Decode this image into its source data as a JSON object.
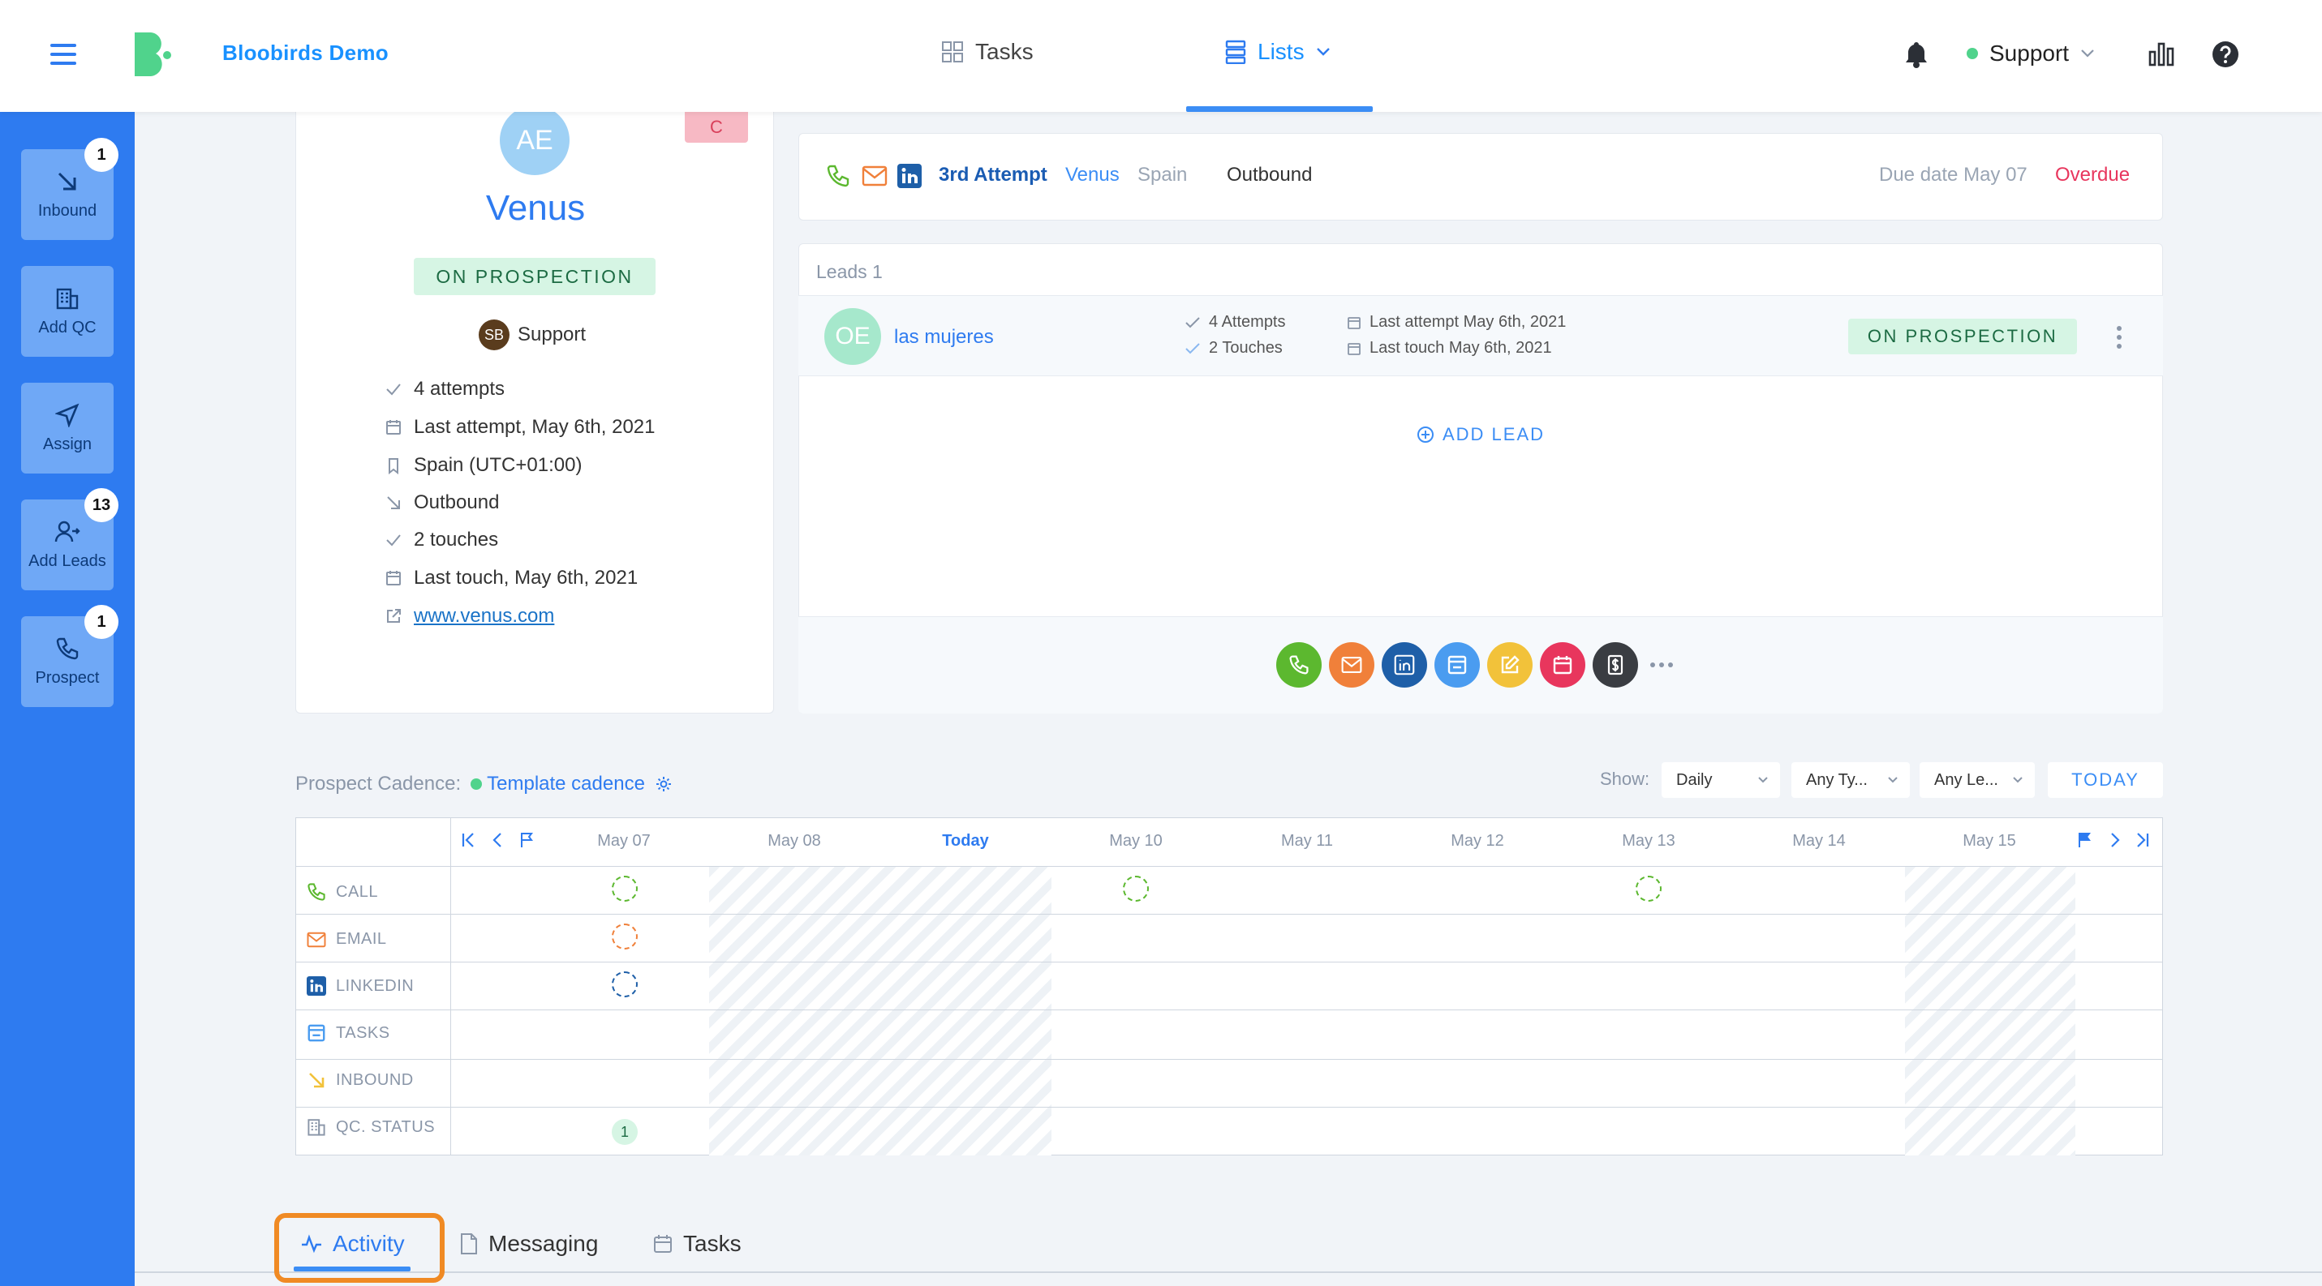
{
  "app": {
    "name": "Bloobirds Demo",
    "brand_color": "#2e7bf0",
    "logo_color": "#50d38c"
  },
  "topnav": {
    "tasks_label": "Tasks",
    "lists_label": "Lists",
    "user_label": "Support",
    "icons": [
      "menu-icon",
      "bell-icon",
      "chart-icon",
      "help-icon"
    ]
  },
  "sidebar": {
    "items": [
      {
        "label": "Inbound",
        "badge": "1",
        "icon": "arrow-down-right-icon"
      },
      {
        "label": "Add QC",
        "badge": "",
        "icon": "building-icon"
      },
      {
        "label": "Assign",
        "badge": "",
        "icon": "send-icon"
      },
      {
        "label": "Add Leads",
        "badge": "13",
        "icon": "user-plus-icon"
      },
      {
        "label": "Prospect",
        "badge": "1",
        "icon": "phone-icon"
      }
    ]
  },
  "company": {
    "initials": "AE",
    "name": "Venus",
    "score": "C",
    "status": "ON PROSPECTION",
    "owner_initials": "SB",
    "owner": "Support",
    "info": [
      {
        "icon": "check-icon",
        "text": "4 attempts"
      },
      {
        "icon": "calendar-icon",
        "text": "Last attempt, May 6th, 2021"
      },
      {
        "icon": "bookmark-icon",
        "text": "Spain (UTC+01:00)"
      },
      {
        "icon": "arrow-down-right-icon",
        "text": "Outbound"
      },
      {
        "icon": "check-icon",
        "text": "2 touches"
      },
      {
        "icon": "calendar-icon",
        "text": "Last touch, May 6th, 2021"
      },
      {
        "icon": "external-link-icon",
        "text": "www.venus.com"
      }
    ]
  },
  "task": {
    "attempt": "3rd Attempt",
    "company": "Venus",
    "country": "Spain",
    "source": "Outbound",
    "due_label": "Due date May 07",
    "overdue": "Overdue"
  },
  "leads": {
    "header": "Leads 1",
    "items": [
      {
        "initials": "OE",
        "name": "las mujeres",
        "attempts": "4 Attempts",
        "touches": "2 Touches",
        "last_attempt": "Last attempt May 6th, 2021",
        "last_touch": "Last touch May 6th, 2021",
        "status": "ON PROSPECTION"
      }
    ],
    "add_label": "ADD LEAD"
  },
  "actions": [
    {
      "name": "call",
      "color": "#5cb82f",
      "icon": "phone-icon"
    },
    {
      "name": "email",
      "color": "#f0803a",
      "icon": "mail-icon"
    },
    {
      "name": "linkedin",
      "color": "#1e5fa8",
      "icon": "linkedin-icon"
    },
    {
      "name": "task",
      "color": "#4a9cf0",
      "icon": "task-icon"
    },
    {
      "name": "note",
      "color": "#f2c23a",
      "icon": "edit-icon"
    },
    {
      "name": "meeting",
      "color": "#e8365d",
      "icon": "calendar-icon"
    },
    {
      "name": "deal",
      "color": "#3a3d42",
      "icon": "dollar-icon"
    }
  ],
  "cadence": {
    "label": "Prospect Cadence:",
    "name": "Template cadence",
    "show_label": "Show:",
    "filters": [
      "Daily",
      "Any Ty...",
      "Any Le..."
    ],
    "today_button": "TODAY",
    "days": [
      "May 07",
      "May 08",
      "Today",
      "May 10",
      "May 11",
      "May 12",
      "May 13",
      "May 14",
      "May 15"
    ],
    "types": [
      {
        "label": "CALL",
        "color": "#5cb82f"
      },
      {
        "label": "EMAIL",
        "color": "#f0803a"
      },
      {
        "label": "LINKEDIN",
        "color": "#1e5fa8"
      },
      {
        "label": "TASKS",
        "color": "#4a9cf0"
      },
      {
        "label": "INBOUND",
        "color": "#f2c23a"
      },
      {
        "label": "QC. STATUS",
        "color": "#8a96a8"
      }
    ],
    "qc_count": "1"
  },
  "tabs": [
    "Activity",
    "Messaging",
    "Tasks"
  ]
}
